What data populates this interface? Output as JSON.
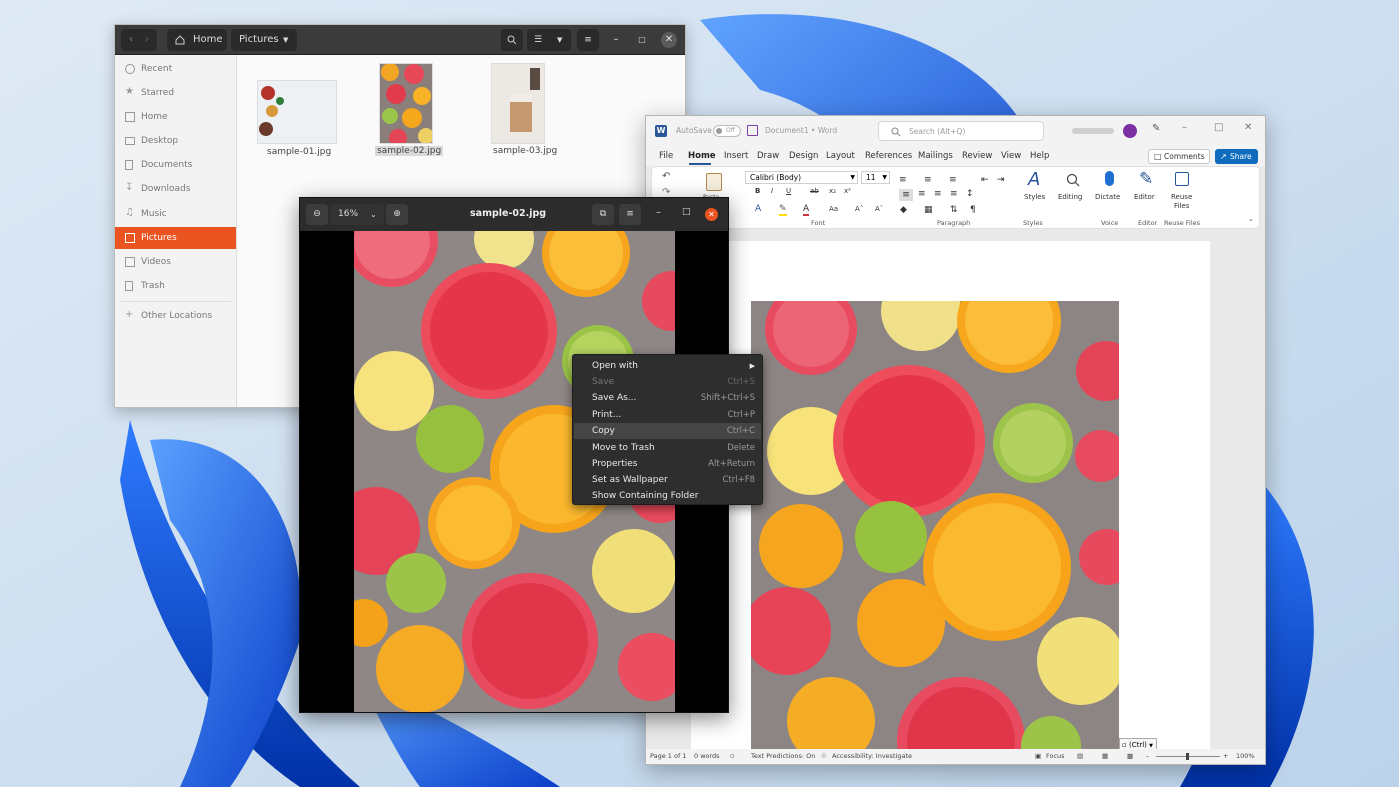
{
  "colors": {
    "ubuntu_orange": "#e95420",
    "word_blue": "#2b579a",
    "share_blue": "#0f6cbd"
  },
  "files": {
    "path_home": "Home",
    "path_current": "Pictures",
    "sidebar": [
      "Recent",
      "Starred",
      "Home",
      "Desktop",
      "Documents",
      "Downloads",
      "Music",
      "Pictures",
      "Videos",
      "Trash"
    ],
    "other_locations": "Other Locations",
    "active_item": "Pictures",
    "thumbnails": [
      "sample-01.jpg",
      "sample-02.jpg",
      "sample-03.jpg"
    ]
  },
  "viewer": {
    "zoom": "16%",
    "title": "sample-02.jpg"
  },
  "context_menu": {
    "items": [
      {
        "label": "Open with",
        "shortcut": "",
        "submenu": true,
        "disabled": false
      },
      {
        "label": "Save",
        "shortcut": "Ctrl+S",
        "disabled": true
      },
      {
        "label": "Save As...",
        "shortcut": "Shift+Ctrl+S",
        "disabled": false
      },
      {
        "label": "Print...",
        "shortcut": "Ctrl+P",
        "disabled": false
      },
      {
        "label": "Copy",
        "shortcut": "Ctrl+C",
        "disabled": false,
        "hovered": true
      },
      {
        "label": "Move to Trash",
        "shortcut": "Delete",
        "disabled": false
      },
      {
        "label": "Properties",
        "shortcut": "Alt+Return",
        "disabled": false
      },
      {
        "label": "Set as Wallpaper",
        "shortcut": "Ctrl+F8",
        "disabled": false
      },
      {
        "label": "Show Containing Folder",
        "shortcut": "",
        "disabled": false
      }
    ]
  },
  "word": {
    "autosave": "AutoSave",
    "autosave_state": "Off",
    "doc_title": "Document1 • Word",
    "search_placeholder": "Search (Alt+Q)",
    "comments": "Comments",
    "share": "Share",
    "tabs": [
      "File",
      "Home",
      "Insert",
      "Draw",
      "Design",
      "Layout",
      "References",
      "Mailings",
      "Review",
      "View",
      "Help"
    ],
    "active_tab": "Home",
    "font_name": "Calibri (Body)",
    "font_size": "11",
    "groups": {
      "font": "Font",
      "paragraph": "Paragraph",
      "styles": "Styles",
      "voice": "Voice",
      "editor": "Editor",
      "reuse": "Reuse Files"
    },
    "buttons": {
      "styles": "Styles",
      "editing": "Editing",
      "dictate": "Dictate",
      "editor": "Editor",
      "reuse_line1": "Reuse",
      "reuse_line2": "Files",
      "paste": "Paste"
    },
    "paste_options": "(Ctrl)",
    "status": {
      "page": "Page 1 of 1",
      "words": "0 words",
      "predictions": "Text Predictions: On",
      "accessibility": "Accessibility: Investigate",
      "focus": "Focus",
      "zoom": "100%"
    }
  }
}
